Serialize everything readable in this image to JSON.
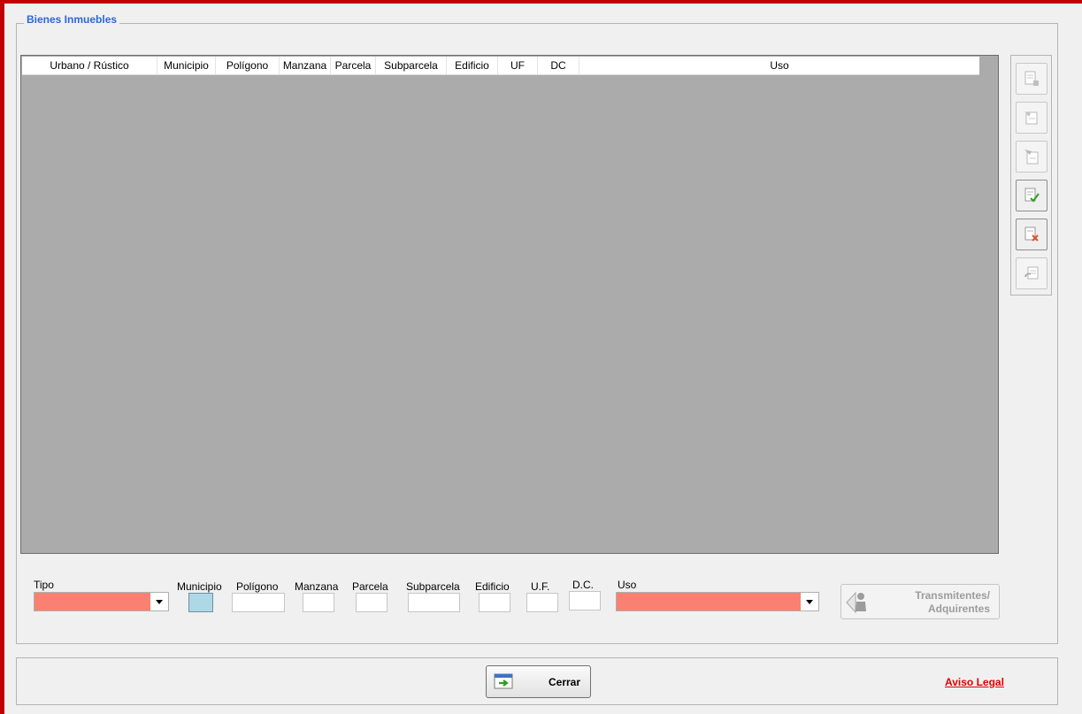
{
  "groupbox": {
    "title": "Bienes Inmuebles"
  },
  "grid": {
    "columns": [
      "Urbano / Rústico",
      "Municipio",
      "Polígono",
      "Manzana",
      "Parcela",
      "Subparcela",
      "Edificio",
      "UF",
      "DC",
      "Uso"
    ],
    "rows": []
  },
  "side_toolbar": {
    "icons": [
      "add-document-icon",
      "edit-document-icon",
      "copy-document-icon",
      "accept-document-icon",
      "delete-document-icon",
      "refresh-document-icon"
    ]
  },
  "form": {
    "tipo": {
      "label": "Tipo",
      "value": ""
    },
    "municipio": {
      "label": "Municipio",
      "value": ""
    },
    "poligono": {
      "label": "Polígono",
      "value": ""
    },
    "manzana": {
      "label": "Manzana",
      "value": ""
    },
    "parcela": {
      "label": "Parcela",
      "value": ""
    },
    "subparcela": {
      "label": "Subparcela",
      "value": ""
    },
    "edificio": {
      "label": "Edificio",
      "value": ""
    },
    "uf": {
      "label": "U.F.",
      "value": ""
    },
    "dc": {
      "label": "D.C.",
      "value": ""
    },
    "uso": {
      "label": "Uso",
      "value": ""
    },
    "required_color": "#fa8072",
    "focus_color": "#add8e6"
  },
  "transmitentes_button": {
    "line1": "Transmitentes/",
    "line2": "Adquirentes",
    "icon": "person-icon"
  },
  "footer": {
    "close_label": "Cerrar",
    "close_icon": "exit-window-icon",
    "legal_link": "Aviso Legal"
  },
  "colors": {
    "frame": "#c00000",
    "legend": "#2c66d8",
    "grid_bg": "#ababab",
    "link": "#e00000"
  }
}
